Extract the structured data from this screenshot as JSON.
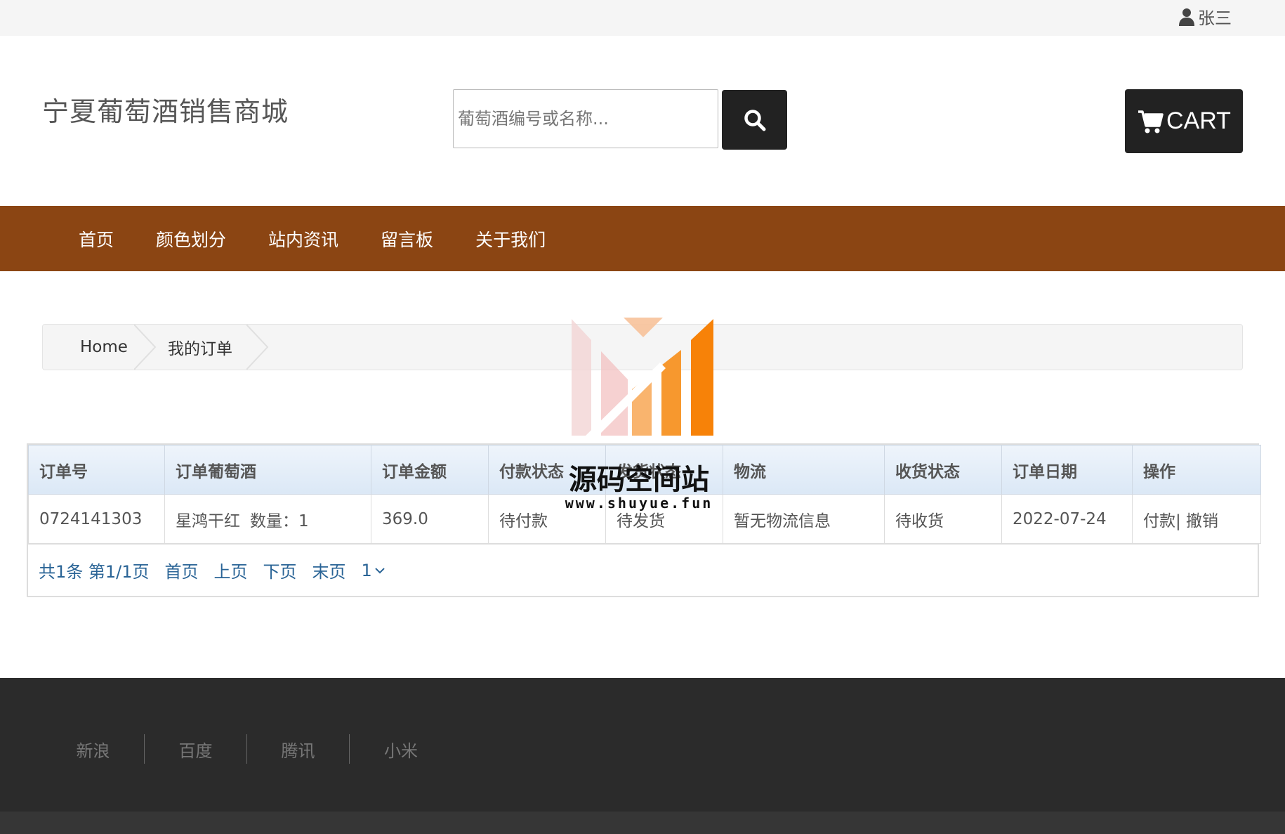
{
  "topbar": {
    "username": "张三",
    "user_icon": "user-icon"
  },
  "header": {
    "site_title": "宁夏葡萄酒销售商城",
    "search": {
      "placeholder": "葡萄酒编号或名称...",
      "value": ""
    },
    "search_icon": "search-icon",
    "cart_label": "CART",
    "cart_icon": "cart-icon"
  },
  "nav": {
    "items": [
      {
        "label": "首页"
      },
      {
        "label": "颜色划分"
      },
      {
        "label": "站内资讯"
      },
      {
        "label": "留言板"
      },
      {
        "label": "关于我们"
      }
    ]
  },
  "breadcrumb": {
    "items": [
      {
        "label": "Home"
      },
      {
        "label": "我的订单"
      }
    ]
  },
  "orders": {
    "columns": [
      "订单号",
      "订单葡萄酒",
      "订单金额",
      "付款状态",
      "发货状态",
      "物流",
      "收货状态",
      "订单日期",
      "操作"
    ],
    "rows": [
      {
        "order_no": "0724141303",
        "wine": "星鸿干红",
        "qty": "数量：1",
        "amount": "369.0",
        "pay_status": "待付款",
        "ship_status": "待发货",
        "logistics": "暂无物流信息",
        "receive_status": "待收货",
        "date": "2022-07-24",
        "actions": "付款| 撤销"
      }
    ],
    "pager": {
      "info": "共1条 第1/1页",
      "first": "首页",
      "prev": "上页",
      "next": "下页",
      "last": "末页",
      "current_page": "1"
    }
  },
  "footer": {
    "links": [
      "新浪",
      "百度",
      "腾讯",
      "小米"
    ]
  },
  "watermark": {
    "title": "源码空间站",
    "url": "www.shuyue.fun"
  },
  "colors": {
    "nav_bg": "#8b4513",
    "dark_button": "#222222",
    "footer_bg": "#2b2b2b",
    "link": "#2a6496"
  }
}
